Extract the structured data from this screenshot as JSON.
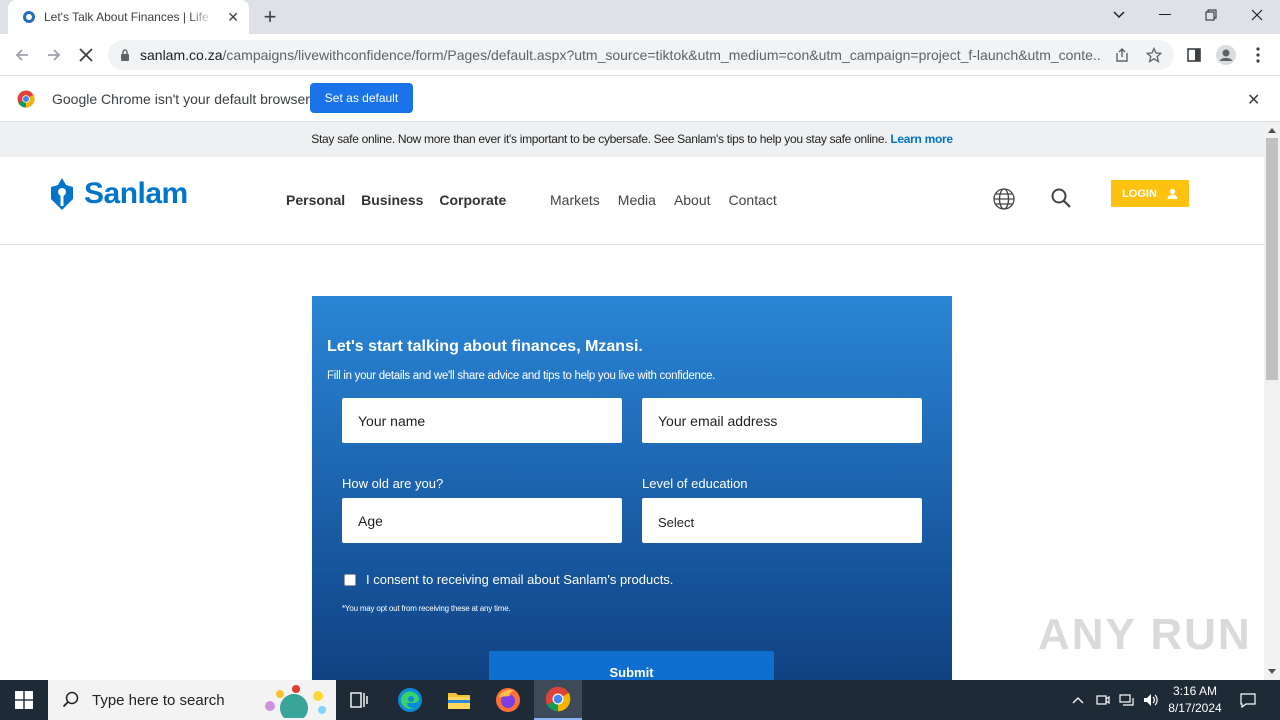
{
  "browser": {
    "tab_title": "Let's Talk About Finances | Life o",
    "url_domain": "sanlam.co.za",
    "url_path": "/campaigns/livewithconfidence/form/Pages/default.aspx?utm_source=tiktok&utm_medium=con&utm_campaign=project_f-launch&utm_conte...",
    "infobar_text": "Google Chrome isn't your default browser",
    "set_default_label": "Set as default"
  },
  "notice": {
    "text": "Stay safe online. Now more than ever it's important to be cybersafe. See Sanlam's tips to help you stay safe online.",
    "link": "Learn more"
  },
  "header": {
    "logo_text": "Sanlam",
    "nav_main": [
      "Personal",
      "Business",
      "Corporate"
    ],
    "nav_secondary": [
      "Markets",
      "Media",
      "About",
      "Contact"
    ],
    "login_label": "LOGIN"
  },
  "form": {
    "title": "Let's start talking about finances, Mzansi.",
    "subtitle": "Fill in your details and we'll share advice and tips to help you live with confidence.",
    "name_placeholder": "Your name",
    "email_placeholder": "Your email address",
    "age_label": "How old are you?",
    "age_placeholder": "Age",
    "education_label": "Level of education",
    "education_value": "Select",
    "consent_text": "I consent to receiving email about Sanlam's products.",
    "optout_text": "*You may opt out from receiving these at any time.",
    "submit_label": "Submit"
  },
  "watermark": "ANY RUN",
  "taskbar": {
    "search_placeholder": "Type here to search",
    "time": "3:16 AM",
    "date": "8/17/2024"
  },
  "colors": {
    "brand_blue": "#0075c9",
    "login_yellow": "#ffc20e",
    "chrome_blue": "#1a73e8"
  }
}
